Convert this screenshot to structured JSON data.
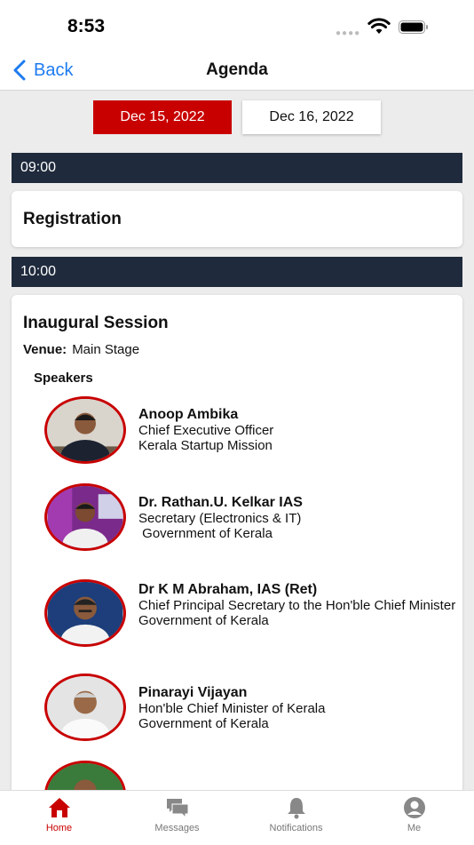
{
  "status_bar": {
    "time": "8:53"
  },
  "nav": {
    "back_label": "Back",
    "title": "Agenda"
  },
  "date_tabs": [
    {
      "label": "Dec 15, 2022",
      "selected": true
    },
    {
      "label": "Dec 16, 2022",
      "selected": false
    }
  ],
  "agenda": [
    {
      "time": "09:00",
      "title": "Registration"
    },
    {
      "time": "10:00",
      "title": "Inaugural Session",
      "venue_label": "Venue:",
      "venue": "Main Stage",
      "speakers_label": "Speakers",
      "speakers": [
        {
          "name": "Anoop Ambika",
          "role": "Chief Executive Officer",
          "org": "Kerala Startup Mission"
        },
        {
          "name": "Dr. Rathan.U. Kelkar IAS",
          "role": "Secretary (Electronics & IT)",
          "org": " Government of Kerala"
        },
        {
          "name": "Dr K M Abraham, IAS (Ret)",
          "role": "Chief Principal Secretary to the Hon'ble Chief Minister",
          "org": "Government of Kerala"
        },
        {
          "name": "Pinarayi Vijayan",
          "role": "Hon'ble Chief Minister of Kerala",
          "org": "Government of Kerala"
        }
      ]
    }
  ],
  "tab_bar": [
    {
      "label": "Home",
      "icon": "home-icon",
      "active": true
    },
    {
      "label": "Messages",
      "icon": "messages-icon",
      "active": false
    },
    {
      "label": "Notifications",
      "icon": "bell-icon",
      "active": false
    },
    {
      "label": "Me",
      "icon": "person-icon",
      "active": false
    }
  ],
  "colors": {
    "accent": "#c80000",
    "time_bar": "#1f2a3c",
    "link": "#1d7bf0"
  }
}
